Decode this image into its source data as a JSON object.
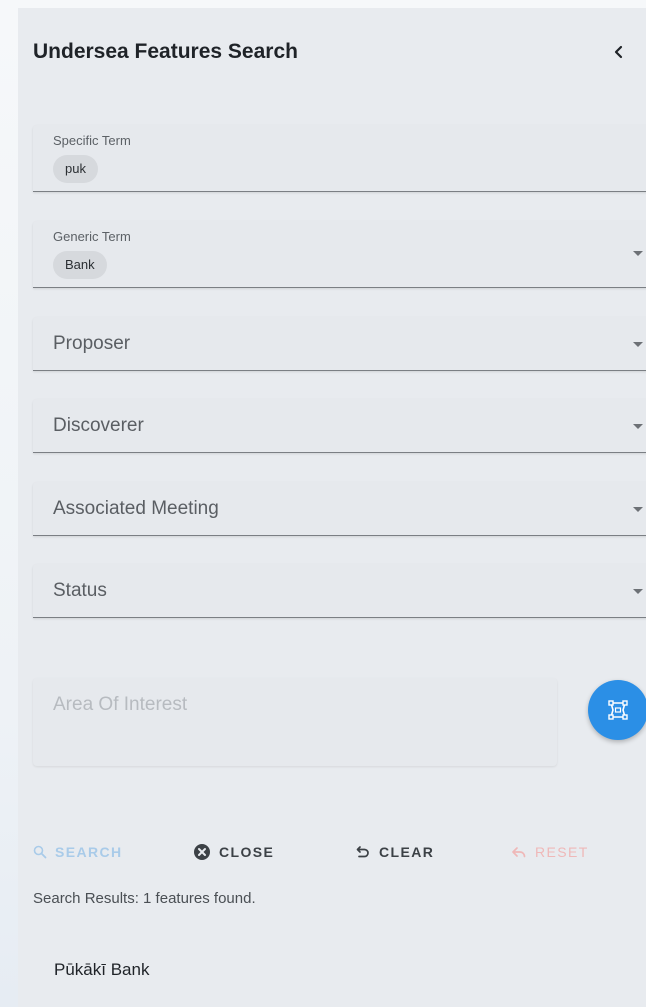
{
  "header": {
    "title": "Undersea Features Search",
    "back_icon": "chevron-left-icon"
  },
  "fields": {
    "specific_term": {
      "label": "Specific Term",
      "chip": "puk"
    },
    "generic_term": {
      "label": "Generic Term",
      "chip": "Bank"
    },
    "proposer": {
      "label": "Proposer"
    },
    "discoverer": {
      "label": "Discoverer"
    },
    "associated_meeting": {
      "label": "Associated Meeting"
    },
    "status": {
      "label": "Status"
    },
    "area_of_interest": {
      "placeholder": "Area Of Interest"
    }
  },
  "draw_button": {
    "icon": "draw-polygon-icon",
    "color": "#2b8fe6"
  },
  "actions": {
    "search": {
      "label": "SEARCH",
      "icon": "search-icon",
      "color": "#a9cbe9"
    },
    "close": {
      "label": "CLOSE",
      "icon": "cancel-circle-icon",
      "color": "#3c4146"
    },
    "clear": {
      "label": "CLEAR",
      "icon": "undo-icon",
      "color": "#3c4146"
    },
    "reset": {
      "label": "RESET",
      "icon": "reply-icon",
      "color": "#efb8b8"
    }
  },
  "results": {
    "summary": "Search Results: 1 features found.",
    "items": [
      {
        "name": "Pūkākī Bank"
      }
    ]
  }
}
